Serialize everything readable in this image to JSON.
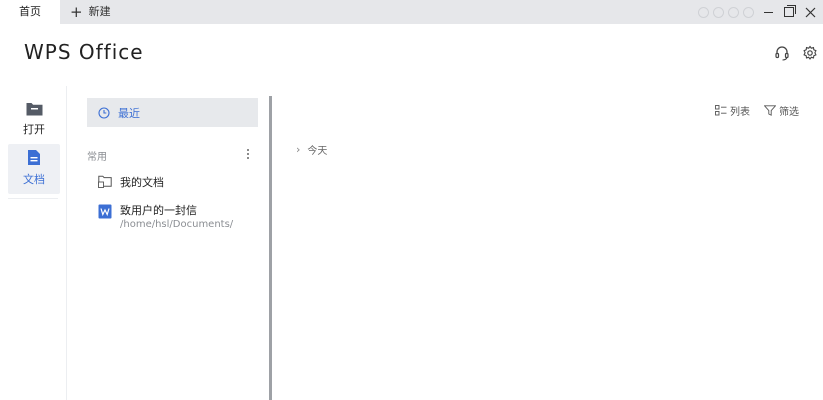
{
  "tabs": {
    "home_label": "首页",
    "new_label": "新建"
  },
  "header": {
    "logo": "WPS Office"
  },
  "rail": {
    "open_label": "打开",
    "docs_label": "文档"
  },
  "sidebar": {
    "recent_label": "最近",
    "section_label": "常用",
    "favorites": [
      {
        "title": "我的文档",
        "subtitle": ""
      },
      {
        "title": "致用户的一封信",
        "subtitle": "/home/hsl/Documents/"
      }
    ]
  },
  "main": {
    "list_label": "列表",
    "filter_label": "筛选",
    "today_label": "今天"
  },
  "colors": {
    "accent": "#3c6fd4",
    "rail_icon": "#555b66"
  }
}
